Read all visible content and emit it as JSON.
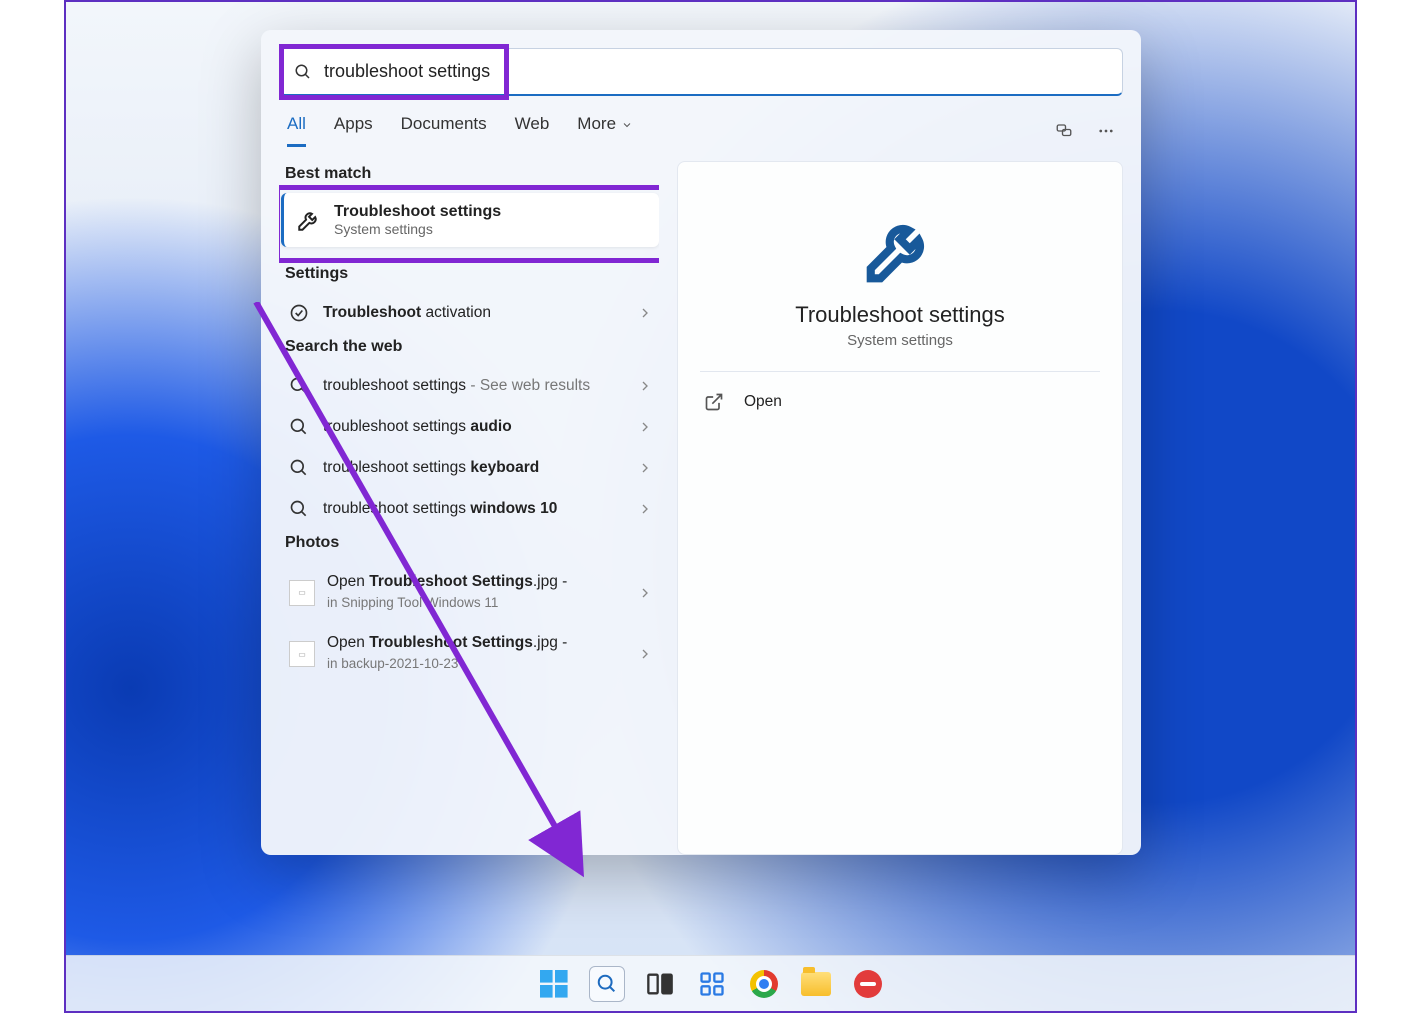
{
  "search": {
    "query": "troubleshoot settings"
  },
  "tabs": {
    "all": "All",
    "apps": "Apps",
    "documents": "Documents",
    "web": "Web",
    "more": "More"
  },
  "sections": {
    "best_match": "Best match",
    "settings": "Settings",
    "search_web": "Search the web",
    "photos": "Photos"
  },
  "best_match": {
    "title": "Troubleshoot settings",
    "subtitle": "System settings"
  },
  "settings_results": {
    "0": {
      "prefix_bold": "Troubleshoot",
      "suffix": " activation"
    }
  },
  "web_results": {
    "0": {
      "text": "troubleshoot settings",
      "suffix": " - See web results"
    },
    "1": {
      "prefix": "troubleshoot settings ",
      "bold": "audio"
    },
    "2": {
      "prefix": "troubleshoot settings ",
      "bold": "keyboard"
    },
    "3": {
      "prefix": "troubleshoot settings ",
      "bold": "windows 10"
    }
  },
  "photo_results": {
    "0": {
      "pre": "Open ",
      "bold": "Troubleshoot Settings",
      "post": ".jpg -",
      "sub": "in Snipping Tool Windows 11"
    },
    "1": {
      "pre": "Open ",
      "bold": "Troubleshoot Settings",
      "post": ".jpg -",
      "sub": "in backup-2021-10-23"
    }
  },
  "detail": {
    "title": "Troubleshoot settings",
    "subtitle": "System settings",
    "open": "Open"
  }
}
